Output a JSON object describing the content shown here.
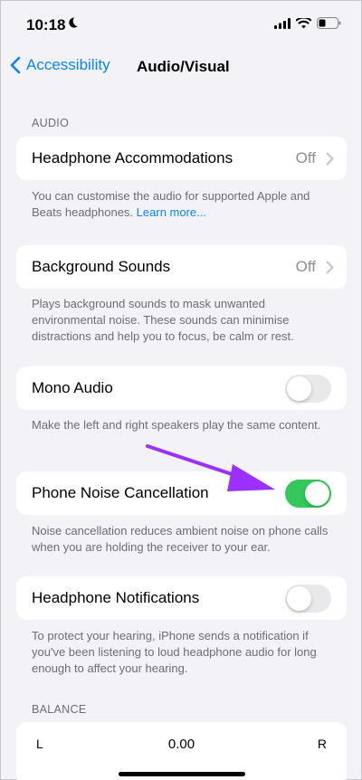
{
  "status": {
    "time": "10:18"
  },
  "nav": {
    "back_label": "Accessibility",
    "title": "Audio/Visual"
  },
  "audio_section": {
    "header": "AUDIO"
  },
  "headphone_accommodations": {
    "label": "Headphone Accommodations",
    "value": "Off",
    "footer": "You can customise the audio for supported Apple and Beats headphones.",
    "footer_link": "Learn more..."
  },
  "background_sounds": {
    "label": "Background Sounds",
    "value": "Off",
    "footer": "Plays background sounds to mask unwanted environmental noise. These sounds can minimise distractions and help you to focus, be calm or rest."
  },
  "mono_audio": {
    "label": "Mono Audio",
    "state": "off",
    "footer": "Make the left and right speakers play the same content."
  },
  "phone_noise_cancellation": {
    "label": "Phone Noise Cancellation",
    "state": "on",
    "footer": "Noise cancellation reduces ambient noise on phone calls when you are holding the receiver to your ear."
  },
  "headphone_notifications": {
    "label": "Headphone Notifications",
    "state": "off",
    "footer": "To protect your hearing, iPhone sends a notification if you've been listening to loud headphone audio for long enough to affect your hearing."
  },
  "balance_section": {
    "header": "BALANCE",
    "left": "L",
    "right": "R",
    "value": "0.00"
  },
  "colors": {
    "accent": "#0a84ff",
    "toggle_on": "#34c759",
    "arrow": "#9b30ff"
  }
}
